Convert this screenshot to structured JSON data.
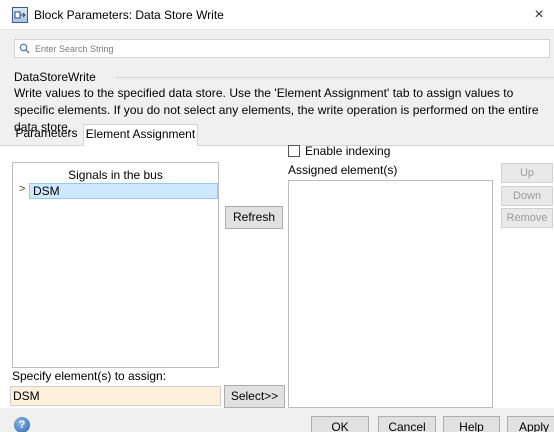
{
  "window": {
    "title": "Block Parameters: Data Store Write",
    "close_glyph": "×"
  },
  "search": {
    "placeholder": "Enter Search String"
  },
  "group": {
    "title": "DataStoreWrite",
    "description": "Write values to the specified data store. Use the 'Element Assignment' tab to assign values to specific elements. If you do not select any elements, the write operation is performed on the entire data store."
  },
  "tabs": [
    {
      "label": "Parameters",
      "active": false
    },
    {
      "label": "Element Assignment",
      "active": true
    }
  ],
  "element_assignment": {
    "enable_indexing_label": "Enable indexing",
    "enable_indexing_checked": false,
    "signals_header": "Signals in the bus",
    "tree": [
      {
        "label": "DSM",
        "expand_glyph": ">",
        "selected": true
      }
    ],
    "refresh_label": "Refresh",
    "assigned_label": "Assigned element(s)",
    "up_label": "Up",
    "down_label": "Down",
    "remove_label": "Remove",
    "specify_label": "Specify element(s) to assign:",
    "specify_value": "DSM",
    "select_label": "Select>>"
  },
  "footer": {
    "help_icon_glyph": "?",
    "ok_label": "OK",
    "cancel_label": "Cancel",
    "help_label": "Help",
    "apply_label": "Apply"
  },
  "colors": {
    "window_bg": "#f0f0f0",
    "panel_bg": "#ffffff",
    "tree_selection": "#cde8ff",
    "specify_field_bg": "#fdf0dd",
    "disabled_text": "#9c9c9c"
  }
}
